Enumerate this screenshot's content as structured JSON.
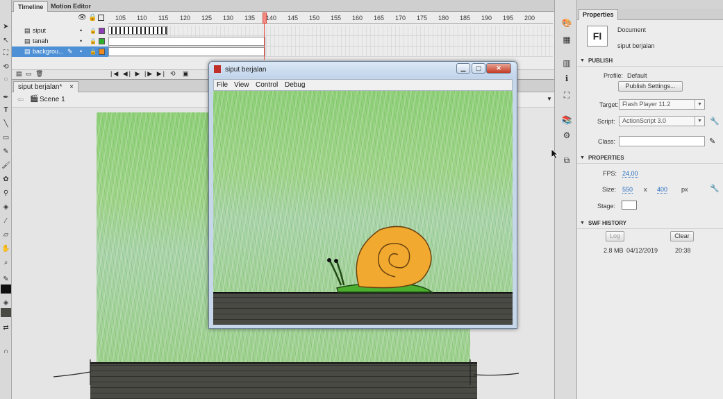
{
  "timeline": {
    "tabs": [
      "Timeline",
      "Motion Editor"
    ],
    "frame_numbers": [
      "105",
      "110",
      "115",
      "120",
      "125",
      "130",
      "135",
      "140",
      "145",
      "150",
      "155",
      "160",
      "165",
      "170",
      "175",
      "180",
      "185",
      "190",
      "195",
      "200"
    ],
    "layers": [
      {
        "name": "siput",
        "color": "#8e3fb5"
      },
      {
        "name": "tanah",
        "color": "#2eaf2e"
      },
      {
        "name": "backgrou...",
        "color": "#f08a1e"
      }
    ]
  },
  "document": {
    "tab_label": "siput berjalan*",
    "tab_close": "×",
    "scene_label": "Scene 1"
  },
  "player": {
    "title": "siput berjalan",
    "menu": [
      "File",
      "View",
      "Control",
      "Debug"
    ]
  },
  "properties": {
    "panel_title": "Properties",
    "doc_icon": "Fl",
    "doc_type": "Document",
    "doc_name": "siput berjalan",
    "publish": {
      "header": "PUBLISH",
      "profile_label": "Profile:",
      "profile_value": "Default",
      "publish_settings_button": "Publish Settings...",
      "target_label": "Target:",
      "target_value": "Flash Player 11.2",
      "script_label": "Script:",
      "script_value": "ActionScript 3.0",
      "class_label": "Class:",
      "class_value": ""
    },
    "props": {
      "header": "PROPERTIES",
      "fps_label": "FPS:",
      "fps_value": "24,00",
      "size_label": "Size:",
      "width": "550",
      "x": "x",
      "height": "400",
      "unit": "px",
      "stage_label": "Stage:",
      "stage_color": "#ffffff"
    },
    "history": {
      "header": "SWF HISTORY",
      "log_button": "Log",
      "clear_button": "Clear",
      "size": "2.8 MB",
      "date": "04/12/2019",
      "time": "20:38"
    }
  },
  "colors": {
    "grass": "#9fd489",
    "snail_shell": "#f2a92f",
    "snail_body": "#4caf2f",
    "selected_layer": "#4d90d6"
  }
}
